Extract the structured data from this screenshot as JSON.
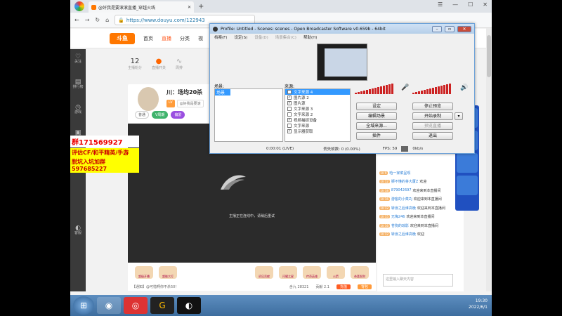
{
  "browser": {
    "tab_title": "@好我是要滚滚直播_穿越火线",
    "url": "https://www.douyu.com/122943",
    "window_controls": [
      "☰",
      "—",
      "☐",
      "✕"
    ]
  },
  "site": {
    "logo": "斗鱼",
    "nav": [
      "首页",
      "直播",
      "分类",
      "视"
    ]
  },
  "leftnav": [
    {
      "icon": "♡",
      "label": "关注"
    },
    {
      "icon": "▤",
      "label": "排行榜"
    },
    {
      "icon": "◷",
      "label": "游戏"
    },
    {
      "icon": "▣",
      "label": "赛事"
    },
    {
      "icon": "◐",
      "label": "客服"
    }
  ],
  "promo": {
    "line1": "群171569927",
    "line2": "评估CF/和平精英/手游",
    "line3": "脱坑入坑加群597685227"
  },
  "stats": [
    {
      "num": "12",
      "label": "主播粉分"
    },
    {
      "num": "",
      "label": "直播开关"
    },
    {
      "num": "",
      "label": "周排"
    }
  ],
  "streamer": {
    "name": "川：场均20杀",
    "tags": [
      "LV",
      "@好我是要滚"
    ],
    "tags2": [
      "普通",
      "V周期",
      "偏爱"
    ]
  },
  "video": {
    "message": "主播正在连线中，请稍后重试"
  },
  "gifts": [
    "超级开播",
    "超能大打",
    "初见贡献",
    "闪耀之星",
    "传奇英雄",
    "火箭",
    "恭喜发财"
  ],
  "bottom": {
    "notice": "【通知】@可惜啊你不杀50！",
    "count1": "含九 28321",
    "count2": "贡献 2.1",
    "btn1": "充值",
    "btn2": "背包"
  },
  "chat": [
    {
      "lv": "LV 9",
      "name": "哈一家菜呈现",
      "text": ""
    },
    {
      "lv": "LV 12",
      "name": "狮不懂的将大厦Z",
      "text": "欢迎"
    },
    {
      "lv": "LV 18",
      "name": "879042697",
      "text": "欢迎来到本直播间"
    },
    {
      "lv": "LV 16",
      "name": "游客的小菜Zj",
      "text": "欢迎来到本直播间"
    },
    {
      "lv": "LV 12",
      "name": "转身之后谁高晚",
      "text": "欢迎来到本直播间"
    },
    {
      "lv": "LV 15",
      "name": "无悔246",
      "text": "欢迎来到本直播间"
    },
    {
      "lv": "LV 16",
      "name": "苍狗的琼影",
      "text": "欢迎来到本直播间"
    },
    {
      "lv": "LV 12",
      "name": "转身之后谁高晚",
      "text": "欢迎"
    }
  ],
  "chat_input_placeholder": "这里输入聊天内容",
  "obs": {
    "title": "Profile: Untitled - Scenes: scenes - Open Broadcaster Software v0.659b - 64bit",
    "menu": [
      "档案(F)",
      "设定(S)",
      "设备(D)",
      "场景集合(C)",
      "帮助(H)"
    ],
    "scenes_label": "场景:",
    "sources_label": "来源:",
    "scenes": [
      "场景"
    ],
    "sources": [
      "文字来源 4",
      "图片源 2",
      "图片源",
      "文字来源 3",
      "文字来源 2",
      "视频捕捉设备",
      "文字来源",
      "显示器获取"
    ],
    "buttons": {
      "settings": "设定",
      "stop_preview": "停止预览",
      "edit_scene": "编辑场景",
      "start_record": "开始录制",
      "global_sources": "全域来源...",
      "preview_only": "预览直播",
      "plugins": "插件",
      "exit": "退出"
    },
    "status": {
      "time": "0:00:01 (LIVE)",
      "dropped": "丢失帧数: 0 (0.00%)",
      "fps": "FPS: 59",
      "bitrate": "0kb/s"
    }
  },
  "taskbar": {
    "time": "19:30",
    "date": "2022/6/1"
  }
}
